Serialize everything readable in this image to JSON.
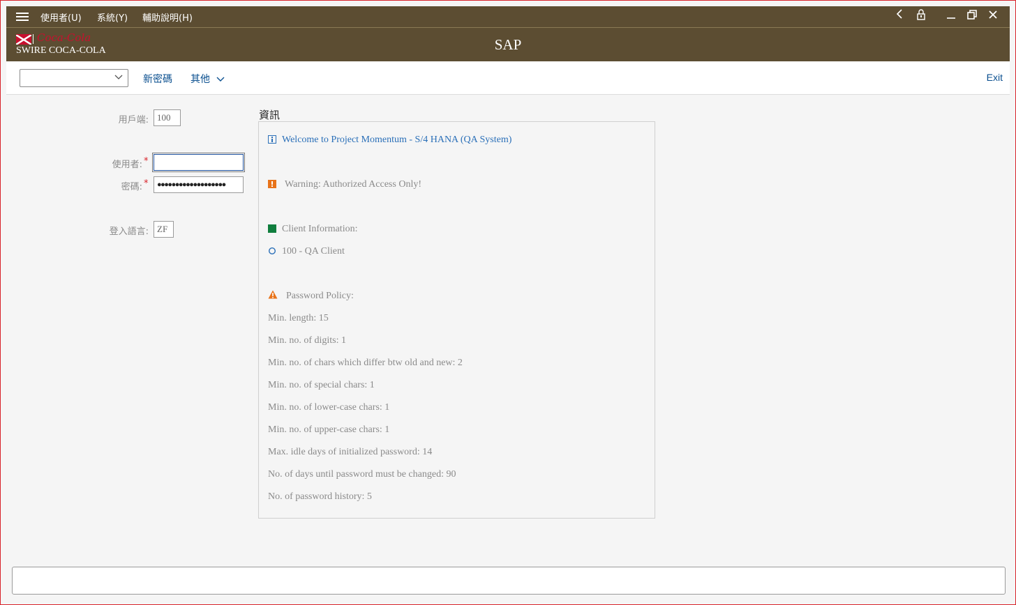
{
  "menu": {
    "items": [
      "使用者(U)",
      "系統(Y)",
      "輔助說明(H)"
    ],
    "window_controls": [
      "back-icon",
      "lock-icon",
      "minimize-icon",
      "restore-icon",
      "close-icon"
    ]
  },
  "header": {
    "logo_script": "Coca-Cola",
    "logo_wordmark": "SWIRE COCA-COLA",
    "title": "SAP"
  },
  "toolbar": {
    "select_value": "",
    "new_password": "新密碼",
    "more": "其他",
    "exit": "Exit"
  },
  "form": {
    "client_label": "用戶端:",
    "client_value": "100",
    "user_label": "使用者:",
    "user_value": "",
    "password_label": "密碼:",
    "password_mask": "●●●●●●●●●●●●●●●●●●●",
    "language_label": "登入語言:",
    "language_value": "ZF",
    "required_marker": "*"
  },
  "info": {
    "title": "資訊",
    "welcome": "Welcome to Project Momentum - S/4 HANA (QA System)",
    "warning": "Warning:  Authorized Access Only!",
    "client_info": "Client Information:",
    "client_entry": "100 - QA Client",
    "policy_title": "Password Policy:",
    "policy_lines": [
      "Min. length: 15",
      "Min. no. of digits: 1",
      "Min. no. of chars which differ btw old and new: 2",
      "Min. no. of special chars: 1",
      "Min. no. of lower-case chars: 1",
      "Min. no. of upper-case chars: 1",
      "Max. idle days of initialized password: 14",
      "No. of days until password must be changed: 90",
      "No. of password history: 5"
    ]
  },
  "colors": {
    "header_bg": "#5c4d32",
    "link": "#0a4f8f",
    "info_link": "#2a6fb8",
    "warning_orange": "#e8731a",
    "success_green": "#107e3e",
    "frame_red": "#d8232a"
  },
  "statusbar": {
    "text": ""
  }
}
